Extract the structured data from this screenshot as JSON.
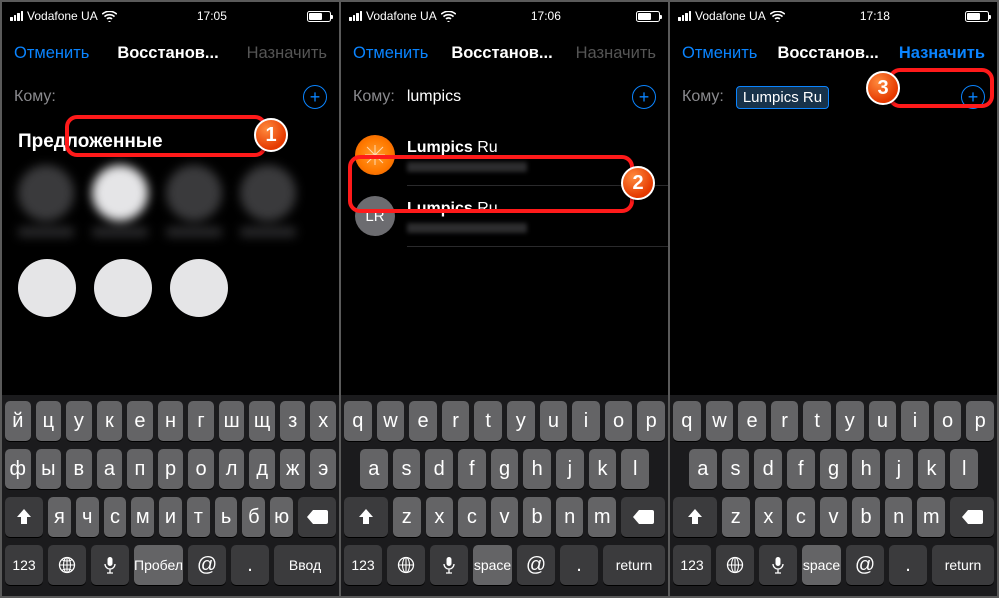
{
  "screens": [
    {
      "status": {
        "carrier": "Vodafone UA",
        "time": "17:05"
      },
      "nav": {
        "cancel": "Отменить",
        "title": "Восстанов...",
        "assign": "Назначить",
        "assign_enabled": false
      },
      "to": {
        "label": "Кому:",
        "value": ""
      },
      "suggested_title": "Предложенные",
      "keyboard": {
        "layout": "ru",
        "rows": [
          [
            "й",
            "ц",
            "у",
            "к",
            "е",
            "н",
            "г",
            "ш",
            "щ",
            "з",
            "х"
          ],
          [
            "ф",
            "ы",
            "в",
            "а",
            "п",
            "р",
            "о",
            "л",
            "д",
            "ж",
            "э"
          ],
          [
            "я",
            "ч",
            "с",
            "м",
            "и",
            "т",
            "ь",
            "б",
            "ю"
          ]
        ],
        "num_key": "123",
        "space": "Пробел",
        "at": "@",
        "dot": ".",
        "return": "Ввод"
      },
      "annotation": {
        "badge": "1"
      }
    },
    {
      "status": {
        "carrier": "Vodafone UA",
        "time": "17:06"
      },
      "nav": {
        "cancel": "Отменить",
        "title": "Восстанов...",
        "assign": "Назначить",
        "assign_enabled": false
      },
      "to": {
        "label": "Кому:",
        "value": "lumpics"
      },
      "results": [
        {
          "avatar": "orange",
          "name_prefix": "Lumpics",
          "name_rest": " Ru"
        },
        {
          "avatar": "LR",
          "name_prefix": "Lumpics",
          "name_rest": " Ru"
        }
      ],
      "keyboard": {
        "layout": "en",
        "rows": [
          [
            "q",
            "w",
            "e",
            "r",
            "t",
            "y",
            "u",
            "i",
            "o",
            "p"
          ],
          [
            "a",
            "s",
            "d",
            "f",
            "g",
            "h",
            "j",
            "k",
            "l"
          ],
          [
            "z",
            "x",
            "c",
            "v",
            "b",
            "n",
            "m"
          ]
        ],
        "num_key": "123",
        "space": "space",
        "at": "@",
        "dot": ".",
        "return": "return"
      },
      "annotation": {
        "badge": "2"
      }
    },
    {
      "status": {
        "carrier": "Vodafone UA",
        "time": "17:18"
      },
      "nav": {
        "cancel": "Отменить",
        "title": "Восстанов...",
        "assign": "Назначить",
        "assign_enabled": true
      },
      "to": {
        "label": "Кому:",
        "chip": "Lumpics Ru"
      },
      "keyboard": {
        "layout": "en",
        "rows": [
          [
            "q",
            "w",
            "e",
            "r",
            "t",
            "y",
            "u",
            "i",
            "o",
            "p"
          ],
          [
            "a",
            "s",
            "d",
            "f",
            "g",
            "h",
            "j",
            "k",
            "l"
          ],
          [
            "z",
            "x",
            "c",
            "v",
            "b",
            "n",
            "m"
          ]
        ],
        "num_key": "123",
        "space": "space",
        "at": "@",
        "dot": ".",
        "return": "return"
      },
      "annotation": {
        "badge": "3"
      }
    }
  ]
}
